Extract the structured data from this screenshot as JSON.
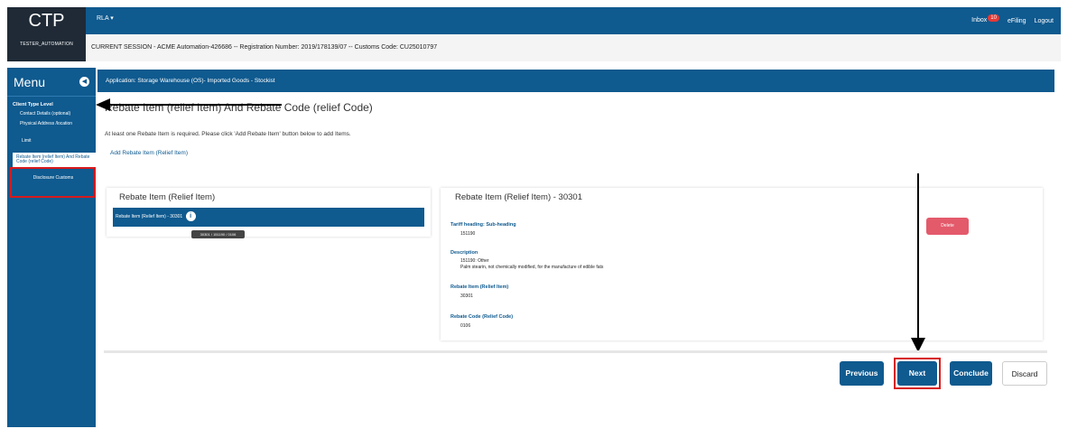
{
  "header": {
    "logo": "CTP",
    "role_dropdown": "RLA",
    "inbox_label": "Inbox",
    "inbox_count": "10",
    "efiling_label": "eFiling",
    "logout_label": "Logout",
    "username": "TESTER_AUTOMATION",
    "session_text": "CURRENT SESSION - ACME Automation-426686 -- Registration Number: 2019/178139/07 -- Customs Code: CU25010797"
  },
  "sidebar": {
    "menu_label": "Menu",
    "section_title": "Client Type Level",
    "items": [
      {
        "label": "Contact Details (optional)"
      },
      {
        "label": "Physical Address /location"
      },
      {
        "label": "Limit"
      },
      {
        "label": "Rebate Item (relief Item) And Rebate Code (relief Code)"
      },
      {
        "label": "Disclosure Customs"
      }
    ]
  },
  "app_bar": {
    "title": "Application: Storage Warehouse (OS)- Imported Goods - Stockist"
  },
  "main": {
    "title": "Rebate Item (relief Item) And Rebate Code (relief Code)",
    "info": "At least one Rebate Item is required. Please click 'Add Rebate Item' button below to add Items.",
    "add_link": "Add Rebate Item (Relief Item)",
    "left_panel": {
      "title": "Rebate Item (Relief Item)",
      "selected_item": "Rebate Item (Relief Item) - 30301",
      "tooltip": "30301 / 151190 / 0106"
    },
    "right_panel": {
      "title": "Rebate Item (Relief Item) - 30301",
      "delete_label": "Delete",
      "fields": [
        {
          "label": "Tariff heading: Sub-heading",
          "value": "151190"
        },
        {
          "label": "Description",
          "value": "151190: Other",
          "value2": "Palm stearin, not chemically modified, for the manufacture of edible fats"
        },
        {
          "label": "Rebate Item (Relief Item)",
          "value": "30301"
        },
        {
          "label": "Rebate Code (Relief Code)",
          "value": "0106"
        }
      ]
    }
  },
  "footer_buttons": {
    "previous": "Previous",
    "next": "Next",
    "conclude": "Conclude",
    "discard": "Discard"
  },
  "colors": {
    "primary": "#0f5a8f",
    "dark": "#1f2a36",
    "highlight": "#d7191c",
    "delete": "#e35a6b"
  }
}
